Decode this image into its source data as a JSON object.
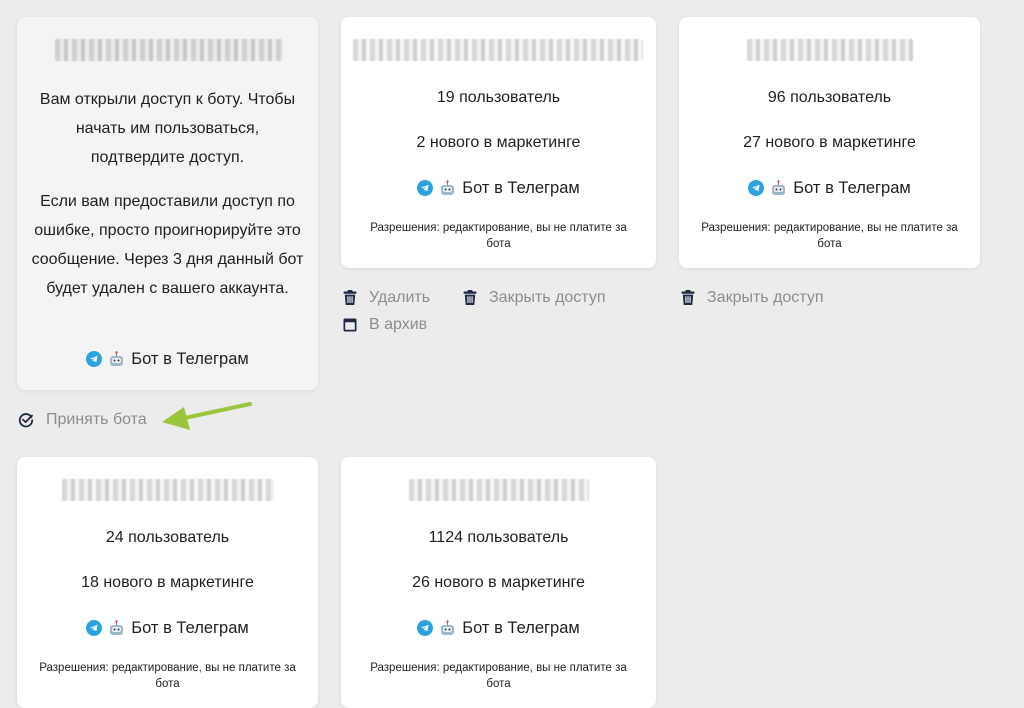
{
  "cards": [
    {
      "notice": "Вам открыли доступ к боту. Чтобы начать им пользоваться, подтвердите доступ.",
      "notice2": "Если вам предоставили доступ по ошибке, просто проигнорируйте это сообщение. Через 3 дня данный бот будет удален с вашего аккаунта.",
      "bot_link": "Бот в Телеграм",
      "actions": [
        {
          "label": "Принять бота",
          "icon": "check-circle-icon"
        }
      ]
    },
    {
      "users": "19 пользователь",
      "marketing": "2 нового в маркетинге",
      "bot_link": "Бот в Телеграм",
      "permissions": "Разрешения: редактирование, вы не платите за бота",
      "actions": [
        {
          "label": "Удалить",
          "icon": "trash-icon"
        },
        {
          "label": "Закрыть доступ",
          "icon": "trash-icon"
        },
        {
          "label": "В архив",
          "icon": "archive-icon"
        }
      ]
    },
    {
      "users": "96 пользователь",
      "marketing": "27 нового в маркетинге",
      "bot_link": "Бот в Телеграм",
      "permissions": "Разрешения: редактирование, вы не платите за бота",
      "actions": [
        {
          "label": "Закрыть доступ",
          "icon": "trash-icon"
        }
      ]
    },
    {
      "users": "24 пользователь",
      "marketing": "18 нового в маркетинге",
      "bot_link": "Бот в Телеграм",
      "permissions": "Разрешения: редактирование, вы не платите за бота"
    },
    {
      "users": "1124 пользователь",
      "marketing": "26 нового в маркетинге",
      "bot_link": "Бот в Телеграм",
      "permissions": "Разрешения: редактирование, вы не платите за бота"
    }
  ],
  "colors": {
    "background": "#ececec",
    "card": "#ffffff",
    "pending_card": "#f4f4f4",
    "action_text": "#8c8c8c",
    "action_icon": "#1e2a44",
    "telegram": "#2aa3df",
    "annotation_arrow": "#9bc53d"
  }
}
